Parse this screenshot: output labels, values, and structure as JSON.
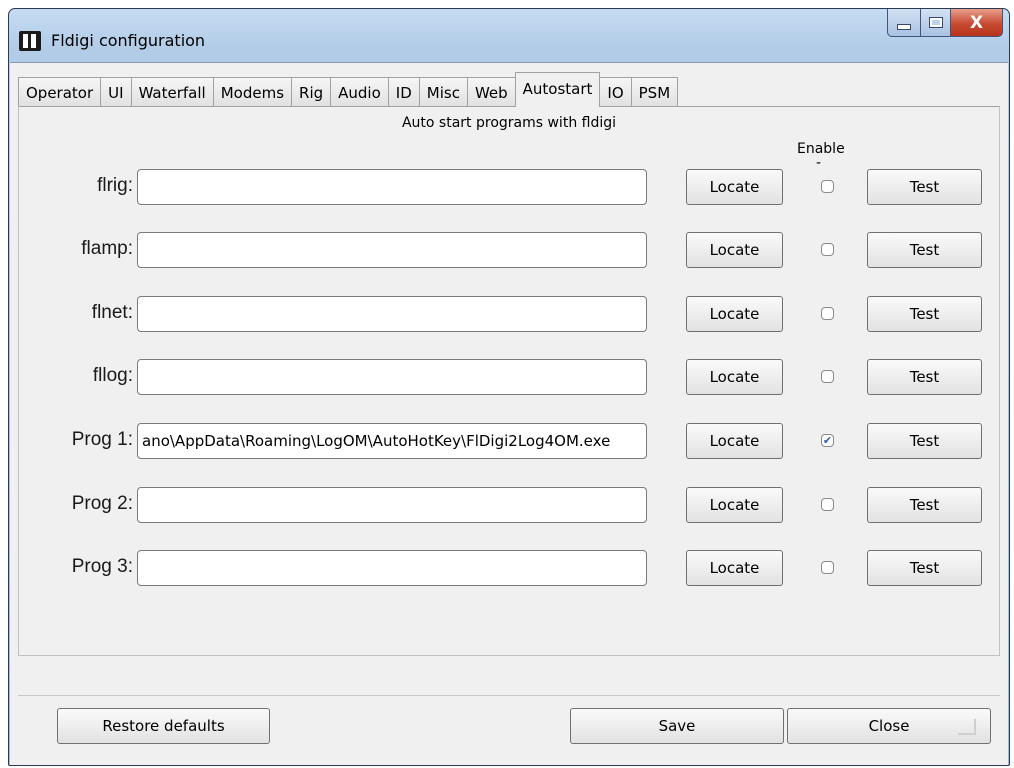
{
  "window": {
    "title": "Fldigi configuration",
    "close_glyph": "X"
  },
  "tabs": [
    {
      "label": "Operator"
    },
    {
      "label": "UI"
    },
    {
      "label": "Waterfall"
    },
    {
      "label": "Modems"
    },
    {
      "label": "Rig"
    },
    {
      "label": "Audio"
    },
    {
      "label": "ID"
    },
    {
      "label": "Misc"
    },
    {
      "label": "Web"
    },
    {
      "label": "Autostart",
      "active": true
    },
    {
      "label": "IO"
    },
    {
      "label": "PSM"
    }
  ],
  "autostart": {
    "heading": "Auto start programs with fldigi",
    "enable_header": "Enable",
    "enable_dash": "-",
    "locate_label": "Locate",
    "test_label": "Test",
    "programs": [
      {
        "label": "flrig:",
        "value": "",
        "enabled": false,
        "placeholder": ""
      },
      {
        "label": "flamp:",
        "value": "",
        "enabled": false,
        "placeholder": ""
      },
      {
        "label": "flnet:",
        "value": "",
        "enabled": false,
        "placeholder": ""
      },
      {
        "label": "fllog:",
        "value": "",
        "enabled": false,
        "placeholder": ""
      },
      {
        "label": "Prog 1:",
        "value": "ano\\AppData\\Roaming\\LogOM\\AutoHotKey\\FlDigi2Log4OM.exe",
        "enabled": true,
        "placeholder": ""
      },
      {
        "label": "Prog 2:",
        "value": "",
        "enabled": false,
        "placeholder": ""
      },
      {
        "label": "Prog 3:",
        "value": "",
        "enabled": false,
        "placeholder": ""
      }
    ]
  },
  "footer": {
    "restore_label": "Restore defaults",
    "save_label": "Save",
    "close_label": "Close"
  },
  "colors": {
    "titlebar": "#b2cce8",
    "close_button": "#c74a32",
    "client_bg": "#f0f0f0",
    "check_mark": "#2a5fb0"
  }
}
